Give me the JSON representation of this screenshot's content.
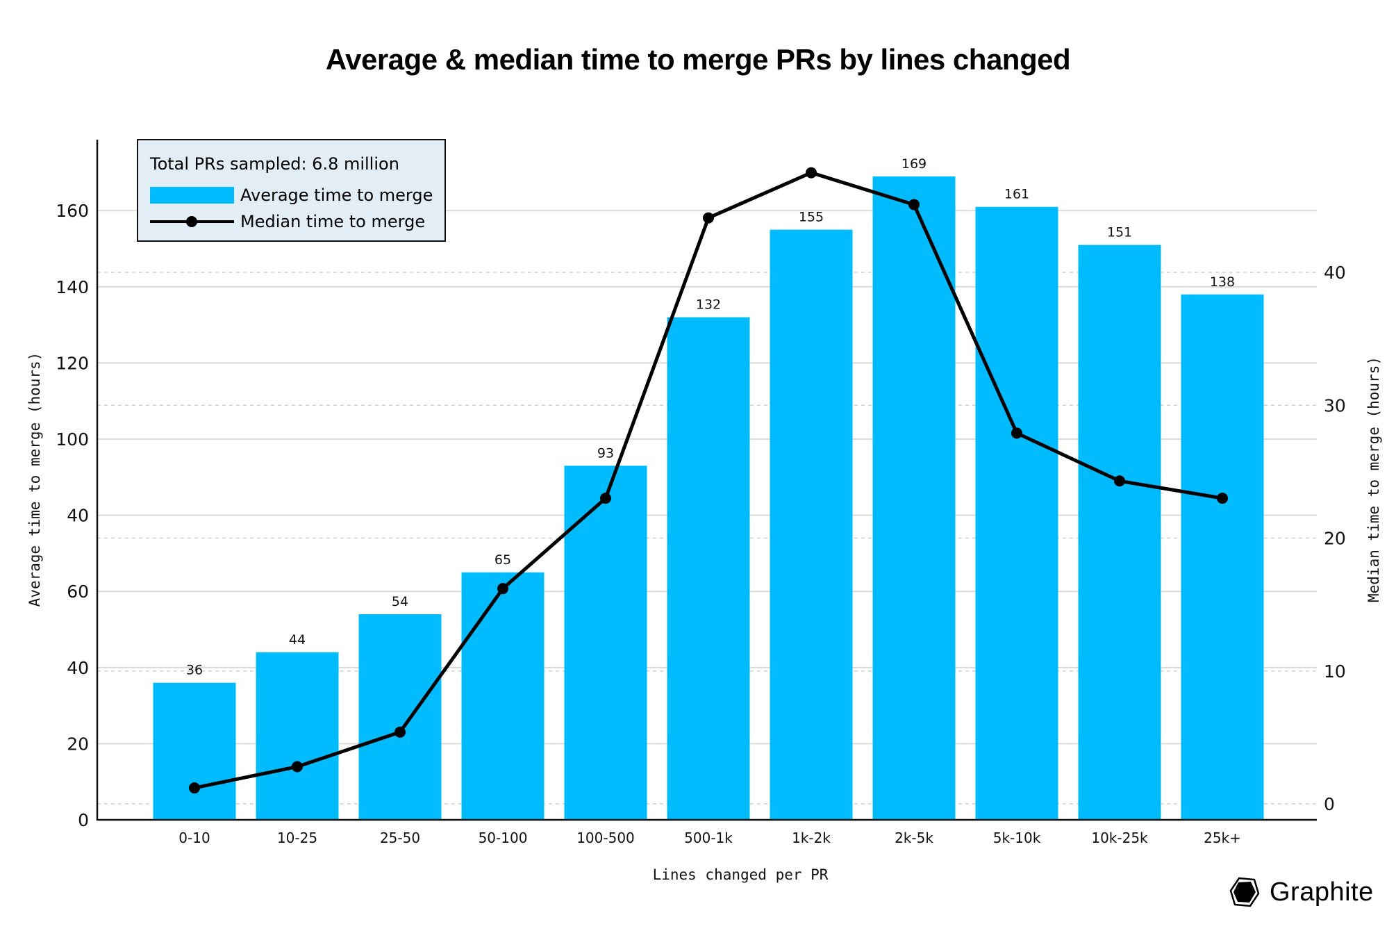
{
  "chart_data": {
    "type": "bar",
    "title": "Average & median time to merge PRs by lines changed",
    "xlabel": "Lines changed per PR",
    "ylabel": "Average time to merge (hours)",
    "y2label": "Median time to merge (hours)",
    "categories": [
      "0-10",
      "10-25",
      "25-50",
      "50-100",
      "100-500",
      "500-1k",
      "1k-2k",
      "2k-5k",
      "5k-10k",
      "10k-25k",
      "25k+"
    ],
    "series": [
      {
        "name": "Average time to merge",
        "type": "bar",
        "axis": "left",
        "color": "#00bcff",
        "values": [
          36,
          44,
          54,
          65,
          93,
          132,
          155,
          169,
          161,
          151,
          138
        ],
        "data_labels": [
          "36",
          "44",
          "54",
          "65",
          "93",
          "132",
          "155",
          "169",
          "161",
          "151",
          "138"
        ]
      },
      {
        "name": "Median time to merge",
        "type": "line",
        "axis": "right",
        "color": "#000000",
        "values": [
          1.2,
          2.8,
          5.4,
          16.2,
          23.0,
          44.1,
          47.5,
          45.1,
          27.9,
          24.3,
          23.0
        ]
      }
    ],
    "ylim": [
      0,
      178
    ],
    "y2lim": [
      -1.2,
      50
    ],
    "yticks": [
      0,
      20,
      40,
      60,
      80,
      100,
      120,
      140,
      160
    ],
    "ytick_labels": [
      "0",
      "20",
      "40",
      "60",
      "40",
      "100",
      "120",
      "140",
      "160"
    ],
    "y2ticks": [
      0,
      10,
      20,
      30,
      40
    ],
    "y2tick_labels": [
      "0",
      "10",
      "20",
      "30",
      "40"
    ],
    "grid": true,
    "legend": {
      "placement": "top-left",
      "title": "Total PRs sampled: 6.8 million",
      "entries": [
        "Average time to merge",
        "Median time to merge"
      ]
    }
  },
  "brand": {
    "name": "Graphite",
    "icon": "graphite-hexagon-icon"
  },
  "colors": {
    "bar": "#00bcff",
    "line": "#000000",
    "legend_bg": "#e3edf6",
    "grid": "#d9d9d9"
  }
}
